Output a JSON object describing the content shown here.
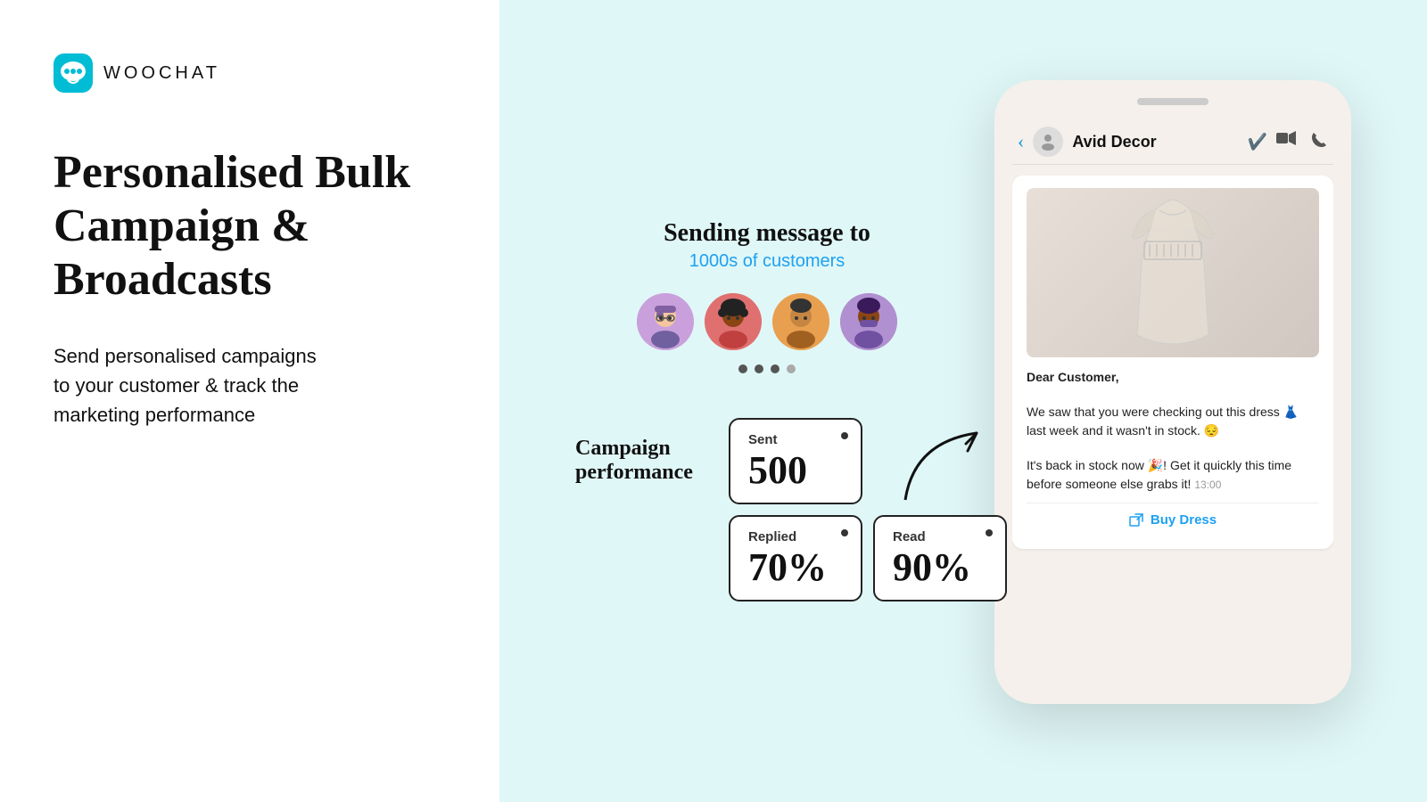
{
  "left": {
    "logo_text": "WOOCHAT",
    "headline": "Personalised Bulk Campaign & Broadcasts",
    "subtext": "Send personalised campaigns\nto your customer & track the\nmarketing performance"
  },
  "center": {
    "sending_title": "Sending message to",
    "sending_subtitle": "1000s of customers",
    "avatars": [
      {
        "emoji": "👩‍💼",
        "bg": "#c9a0dc"
      },
      {
        "emoji": "👩",
        "bg": "#e07070"
      },
      {
        "emoji": "👨",
        "bg": "#e8a050"
      },
      {
        "emoji": "👩‍🦱",
        "bg": "#b090d0"
      }
    ],
    "campaign_label": "Campaign performance",
    "stats": {
      "sent_label": "Sent",
      "sent_value": "500",
      "replied_label": "Replied",
      "replied_value": "70%",
      "read_label": "Read",
      "read_value": "90%"
    }
  },
  "phone": {
    "contact_name": "Avid Decor",
    "message_greeting": "Dear Customer,",
    "message_body1": "We saw that you were checking out this dress 👗 last week and it wasn't in stock. 😔",
    "message_body2": "It's back in stock now 🎉! Get it quickly this time before someone else grabs it!",
    "message_time": "13:00",
    "buy_button_label": "Buy Dress"
  }
}
